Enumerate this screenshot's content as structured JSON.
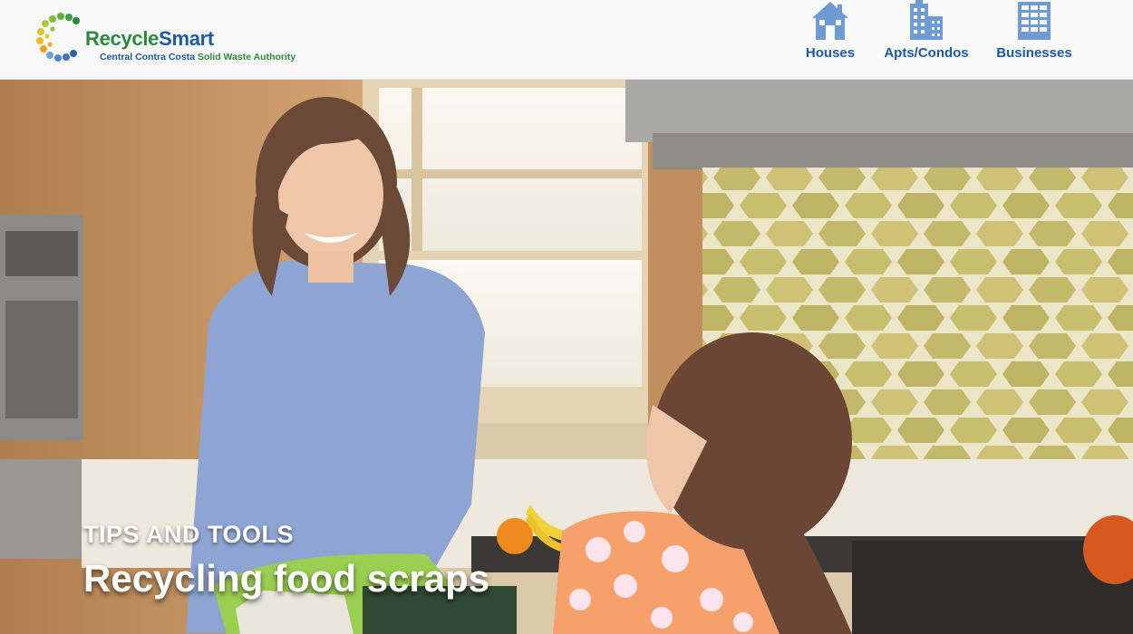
{
  "brand": {
    "name_part1": "Recycle",
    "name_part2": "Smart",
    "subtitle_part1": "Central Contra Costa ",
    "subtitle_part2": "Solid Waste Authority",
    "colors": {
      "green": "#2a8c3a",
      "blue": "#1f5aa6"
    }
  },
  "nav": {
    "items": [
      {
        "label": "Houses",
        "icon": "house-icon"
      },
      {
        "label": "Apts/Condos",
        "icon": "apartment-building-icon"
      },
      {
        "label": "Businesses",
        "icon": "office-building-icon"
      }
    ]
  },
  "hero": {
    "kicker": "TIPS AND TOOLS",
    "headline": "Recycling food scraps"
  }
}
